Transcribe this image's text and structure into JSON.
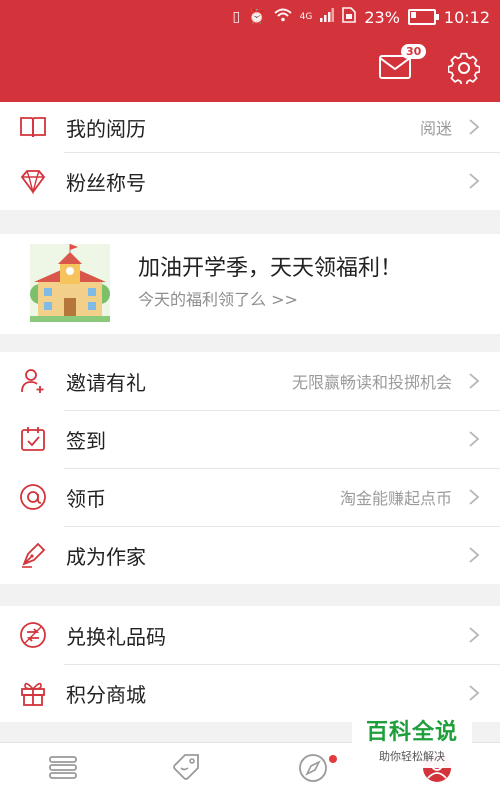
{
  "status_bar": {
    "battery": "23%",
    "time": "10:12",
    "network_label": "4G",
    "battery_level": 0.23
  },
  "header": {
    "mail_badge": "30"
  },
  "group1": {
    "items": [
      {
        "label": "我的阅历",
        "hint": "阅迷"
      },
      {
        "label": "粉丝称号",
        "hint": ""
      }
    ]
  },
  "promo": {
    "title": "加油开学季，天天领福利！",
    "subtitle": "今天的福利领了么 >>"
  },
  "group2": {
    "items": [
      {
        "label": "邀请有礼",
        "hint": "无限赢畅读和投掷机会"
      },
      {
        "label": "签到",
        "hint": ""
      },
      {
        "label": "领币",
        "hint": "淘金能赚起点币"
      },
      {
        "label": "成为作家",
        "hint": ""
      }
    ]
  },
  "group3": {
    "items": [
      {
        "label": "兑换礼品码",
        "hint": ""
      },
      {
        "label": "积分商城",
        "hint": ""
      }
    ]
  },
  "watermark": {
    "title": "百科全说",
    "subtitle": "助你轻松解决"
  },
  "colors": {
    "accent": "#d3343b",
    "watermark_green": "#1f9f3a"
  }
}
